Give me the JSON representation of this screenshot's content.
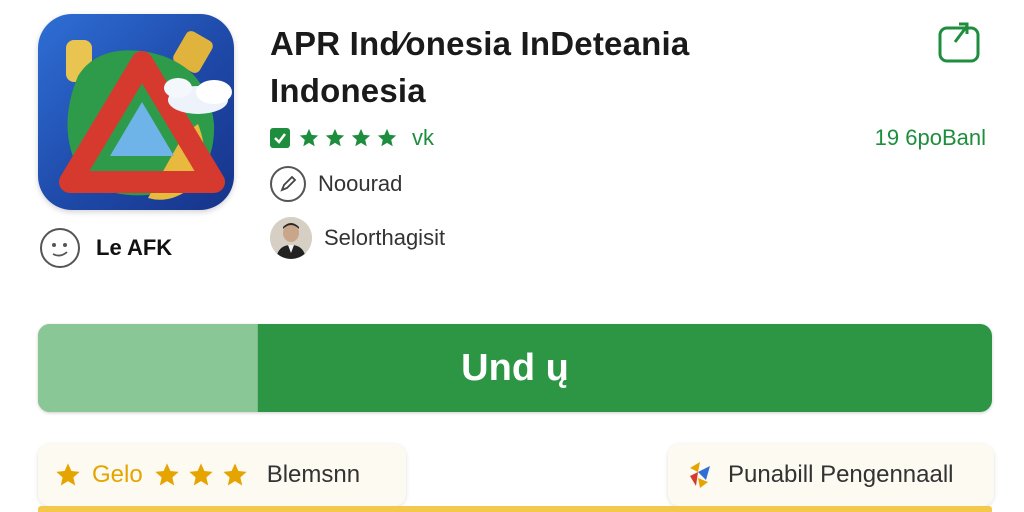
{
  "app": {
    "title_line1": "APR Ind∕onesia InDeteania",
    "title_line2": "Indonesia",
    "rating_value": "vk",
    "rating_stars": 4,
    "downloads": "19 6poBanl",
    "meta1": "Noourad",
    "meta2": "Selorthagisit",
    "apk_label": "Le AFK"
  },
  "install": {
    "label": "Und ų",
    "progress_fraction": 0.23
  },
  "chips": {
    "left_label": "Gelo",
    "left_stars": 3,
    "left_text": "Blemsnn",
    "right_text": "Punabill Pengennaall"
  },
  "colors": {
    "accent_green": "#2c9645",
    "progress_green": "#8ac796",
    "star_gold": "#e5a400",
    "text_green": "#1e8e3e"
  },
  "icons": [
    "app-icon",
    "share-icon",
    "verified-icon",
    "star-icon",
    "pencil-circle-icon",
    "avatar",
    "face-icon",
    "puzzle-icon"
  ]
}
